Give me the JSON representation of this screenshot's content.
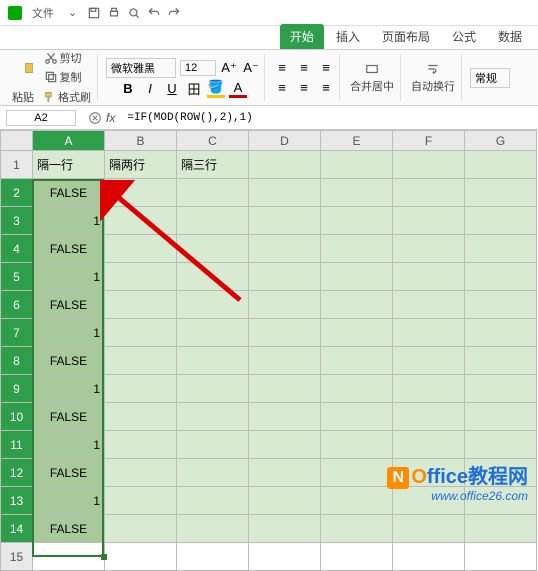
{
  "menubar": {
    "file": "文件",
    "dropdown": "⌄"
  },
  "tabs": {
    "start": "开始",
    "insert": "插入",
    "layout": "页面布局",
    "formula": "公式",
    "data": "数据"
  },
  "ribbon": {
    "cut": "剪切",
    "copy": "复制",
    "paste": "粘贴",
    "formatPainter": "格式刷",
    "font": "微软雅黑",
    "size": "12",
    "merge": "合并居中",
    "wrap": "自动换行",
    "style": "常规"
  },
  "namebox": "A2",
  "formula": "=IF(MOD(ROW(),2),1)",
  "cols": [
    "A",
    "B",
    "C",
    "D",
    "E",
    "F",
    "G"
  ],
  "rows": [
    "1",
    "2",
    "3",
    "4",
    "5",
    "6",
    "7",
    "8",
    "9",
    "10",
    "11",
    "12",
    "13",
    "14",
    "15"
  ],
  "headers": {
    "c1": "隔一行",
    "c2": "隔两行",
    "c3": "隔三行"
  },
  "cells": {
    "a2": "FALSE",
    "a3": "1",
    "a4": "FALSE",
    "a5": "1",
    "a6": "FALSE",
    "a7": "1",
    "a8": "FALSE",
    "a9": "1",
    "a10": "FALSE",
    "a11": "1",
    "a12": "FALSE",
    "a13": "1",
    "a14": "FALSE"
  },
  "watermark": {
    "brand_o": "O",
    "brand_rest": "ffice教程网",
    "url": "www.office26.com",
    "logo": "N"
  }
}
